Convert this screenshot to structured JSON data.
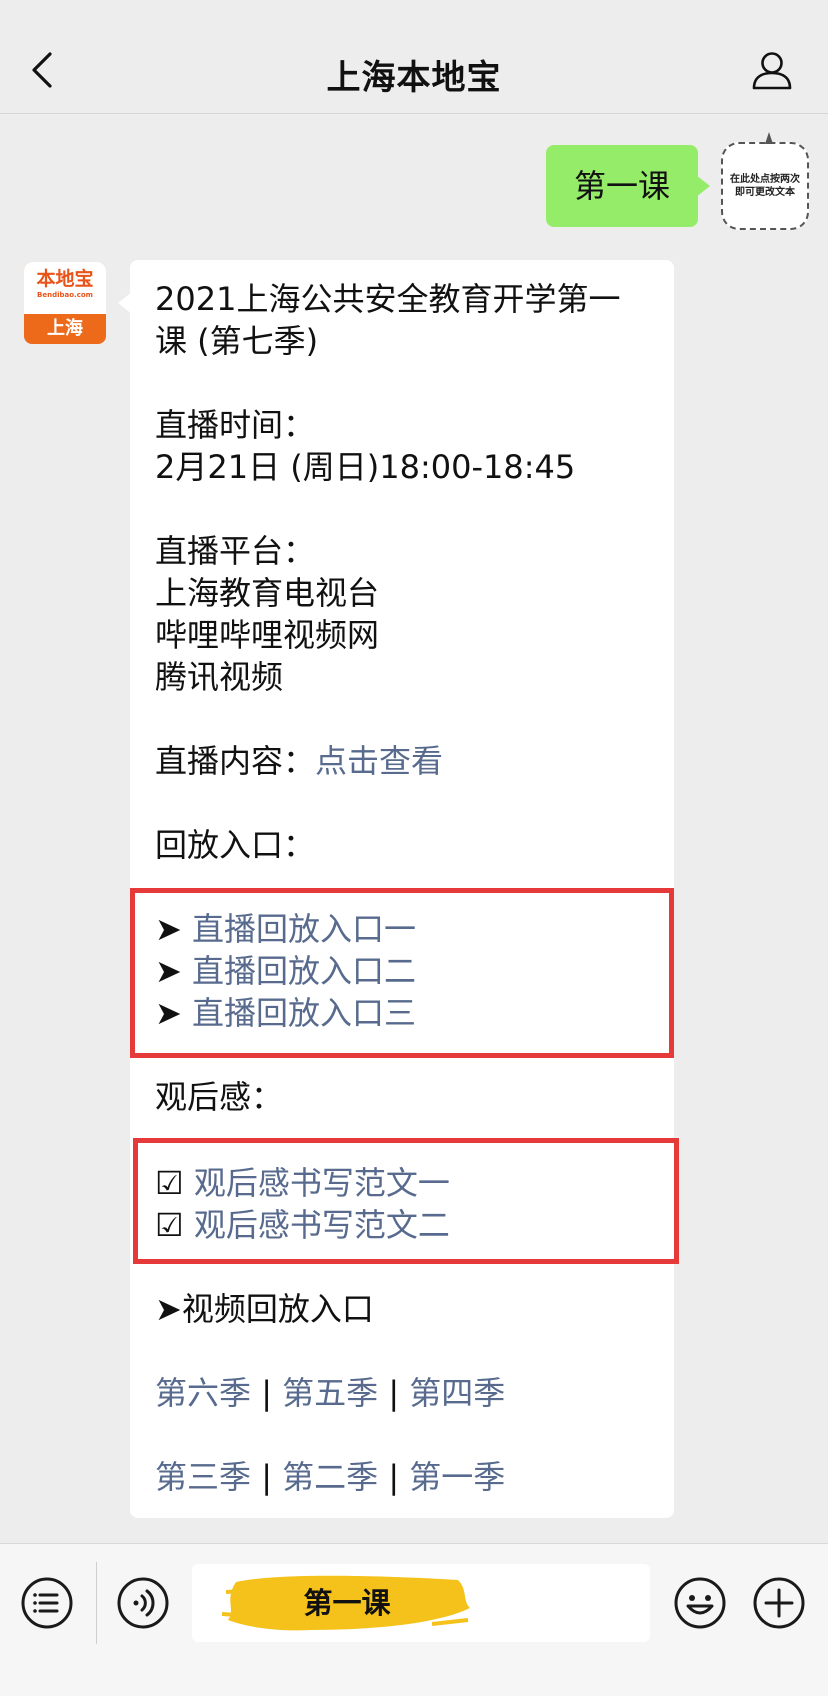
{
  "header": {
    "title": "上海本地宝"
  },
  "user_message": {
    "text": "第一课",
    "avatar_note": "在此处点按两次即可更改文本"
  },
  "bot": {
    "avatar_brand": "本地宝",
    "avatar_domain": "Bendibao.com",
    "avatar_city": "上海",
    "title_line1": "2021上海公共安全教育开学第一",
    "title_line2": "课 (第七季)",
    "time_label": "直播时间：",
    "time_value": "2月21日 (周日)18:00-18:45",
    "platform_label": "直播平台：",
    "platforms": [
      "上海教育电视台",
      "哔哩哔哩视频网",
      "腾讯视频"
    ],
    "content_label": "直播内容：",
    "content_link": "点击查看",
    "replay_label": "回放入口：",
    "replay_bullet": "➤",
    "replay_links": [
      "直播回放入口一",
      "直播回放入口二",
      "直播回放入口三"
    ],
    "review_label": "观后感：",
    "review_check": "☑",
    "review_links": [
      "观后感书写范文一",
      "观后感书写范文二"
    ],
    "video_replay": "➤视频回放入口",
    "separator": "|",
    "seasons_row1": [
      "第六季",
      "第五季",
      "第四季"
    ],
    "seasons_row2": [
      "第三季",
      "第二季",
      "第一季"
    ]
  },
  "bottom_bar": {
    "input_text": "第一课"
  },
  "colors": {
    "link": "#586b8e",
    "user_bubble": "#95ec69",
    "highlight_box": "#e5393a",
    "brand_orange": "#ee6a1b",
    "brush_yellow": "#f4c21a"
  }
}
